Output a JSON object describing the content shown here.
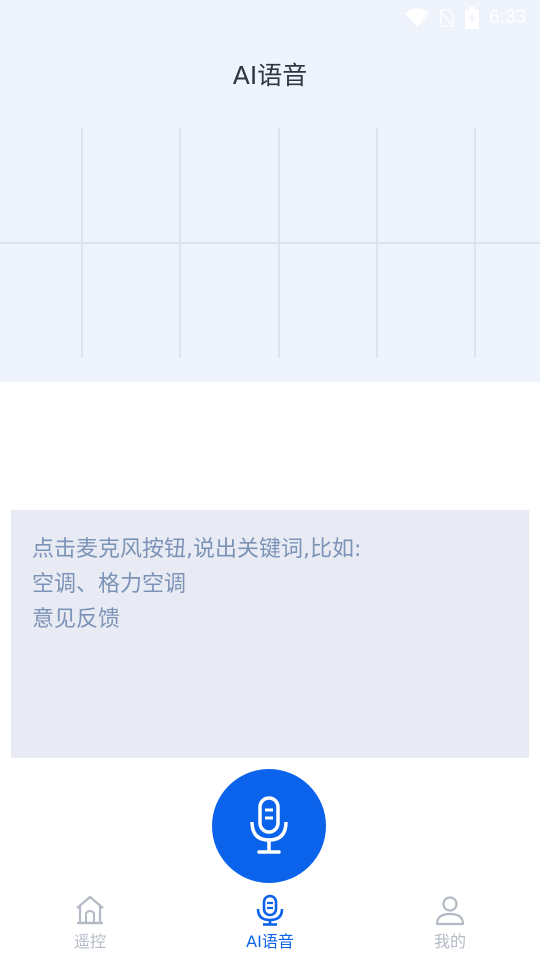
{
  "status_bar": {
    "time": "6:33"
  },
  "header": {
    "title": "AI语音"
  },
  "hint": {
    "lines": [
      "点击麦克风按钮,说出关键词,比如:",
      "空调、格力空调",
      "意见反馈"
    ]
  },
  "mic": {
    "icon": "microphone-icon"
  },
  "tabs": [
    {
      "label": "遥控",
      "icon": "home-icon",
      "active": false
    },
    {
      "label": "AI语音",
      "icon": "microphone-icon",
      "active": true
    },
    {
      "label": "我的",
      "icon": "person-icon",
      "active": false
    }
  ],
  "colors": {
    "accent": "#0b63ec",
    "top_bg": "#eff3fb",
    "hint_bg": "#e8ebf3",
    "hint_text": "#7c93b8",
    "inactive": "#b3bac6"
  }
}
